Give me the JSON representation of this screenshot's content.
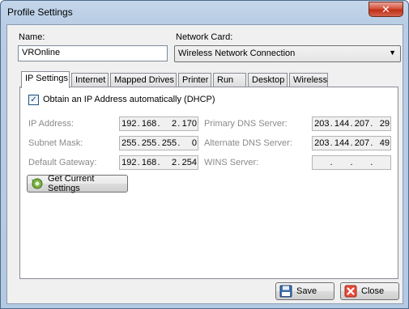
{
  "window": {
    "title": "Profile Settings",
    "close_glyph": "✕"
  },
  "name_field": {
    "label": "Name:",
    "value": "VROnline"
  },
  "network_card": {
    "label": "Network Card:",
    "value": "Wireless Network Connection"
  },
  "tabs": [
    {
      "label": "IP Settings",
      "active": true
    },
    {
      "label": "Internet"
    },
    {
      "label": "Mapped Drives"
    },
    {
      "label": "Printer"
    },
    {
      "label": "Run"
    },
    {
      "label": "Desktop"
    },
    {
      "label": "Wireless"
    }
  ],
  "ip_settings": {
    "dhcp_label": "Obtain an IP Address automatically (DHCP)",
    "dhcp_checked": true,
    "ip_address": {
      "label": "IP Address:",
      "octets": [
        "192",
        "168",
        "2",
        "170"
      ]
    },
    "subnet_mask": {
      "label": "Subnet Mask:",
      "octets": [
        "255",
        "255",
        "255",
        "0"
      ]
    },
    "default_gateway": {
      "label": "Default Gateway:",
      "octets": [
        "192",
        "168",
        "2",
        "254"
      ]
    },
    "primary_dns": {
      "label": "Primary DNS Server:",
      "octets": [
        "203",
        "144",
        "207",
        "29"
      ]
    },
    "alternate_dns": {
      "label": "Alternate DNS Server:",
      "octets": [
        "203",
        "144",
        "207",
        "49"
      ]
    },
    "wins_server": {
      "label": "WINS Server:",
      "octets": [
        "",
        "",
        "",
        ""
      ]
    },
    "get_current_label": "Get Current Settings"
  },
  "footer": {
    "save_label": "Save",
    "close_label": "Close"
  },
  "icons": {
    "get_current": "network-refresh-icon",
    "save": "floppy-disk-icon",
    "close": "red-x-icon",
    "dropdown": "chevron-down-icon"
  }
}
